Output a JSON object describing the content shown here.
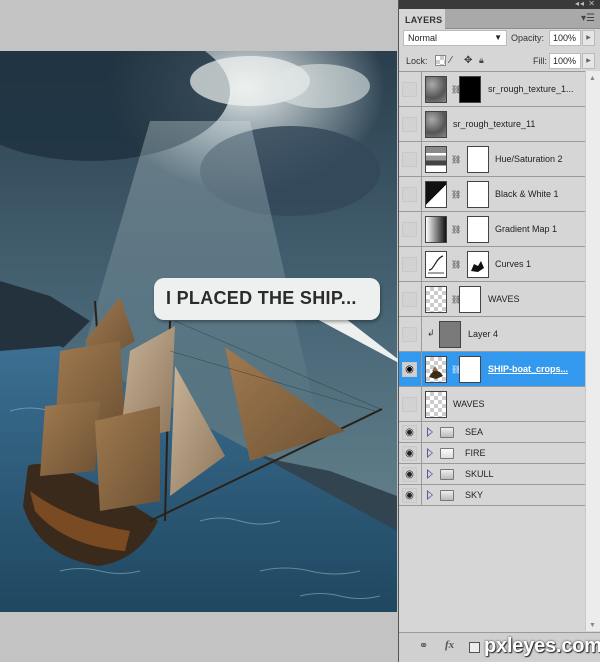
{
  "canvas": {
    "speech_bubble": "I PLACED THE SHIP..."
  },
  "panel": {
    "topbar_buttons": "◂◂ ✕",
    "tab": "LAYERS",
    "menu_icon": "panel-menu-icon",
    "blend_mode": "Normal",
    "opacity_label": "Opacity:",
    "opacity_value": "100%",
    "lock_label": "Lock:",
    "fill_label": "Fill:",
    "fill_value": "100%",
    "layers": [
      {
        "name": "sr_rough_texture_1...",
        "type": "layer-with-mask",
        "visible": false,
        "thumb": "texture",
        "mask": "black"
      },
      {
        "name": "sr_rough_texture_11",
        "type": "layer",
        "visible": false,
        "thumb": "texture"
      },
      {
        "name": "Hue/Saturation 2",
        "type": "adjustment",
        "visible": false,
        "thumb": "hue-saturation",
        "mask": "white"
      },
      {
        "name": "Black & White 1",
        "type": "adjustment",
        "visible": false,
        "thumb": "black-white",
        "mask": "white"
      },
      {
        "name": "Gradient Map 1",
        "type": "adjustment",
        "visible": false,
        "thumb": "gradient-map",
        "mask": "white"
      },
      {
        "name": "Curves 1",
        "type": "adjustment",
        "visible": false,
        "thumb": "curves",
        "mask": "painted"
      },
      {
        "name": "WAVES",
        "type": "layer-with-mask",
        "visible": false,
        "thumb": "transparent",
        "mask": "white"
      },
      {
        "name": "Layer 4",
        "type": "clipped-layer",
        "visible": false,
        "thumb": "gray"
      },
      {
        "name": "SHIP-boat_crops...",
        "type": "layer-with-mask",
        "visible": true,
        "selected": true,
        "thumb": "ship",
        "mask": "white"
      },
      {
        "name": "WAVES",
        "type": "layer",
        "visible": false,
        "thumb": "transparent"
      },
      {
        "name": "SEA",
        "type": "group",
        "visible": true
      },
      {
        "name": "FIRE",
        "type": "group",
        "visible": true
      },
      {
        "name": "SKULL",
        "type": "group",
        "visible": true
      },
      {
        "name": "SKY",
        "type": "group",
        "visible": true
      }
    ],
    "bottom_icons": [
      "link-icon",
      "fx-icon",
      "mask-icon"
    ],
    "fx_label": "fx"
  },
  "watermark": "pxleyes.com",
  "colors": {
    "selection": "#3399ee",
    "panel_bg": "#d6d6d6",
    "workspace_bg": "#c3c3c3"
  }
}
